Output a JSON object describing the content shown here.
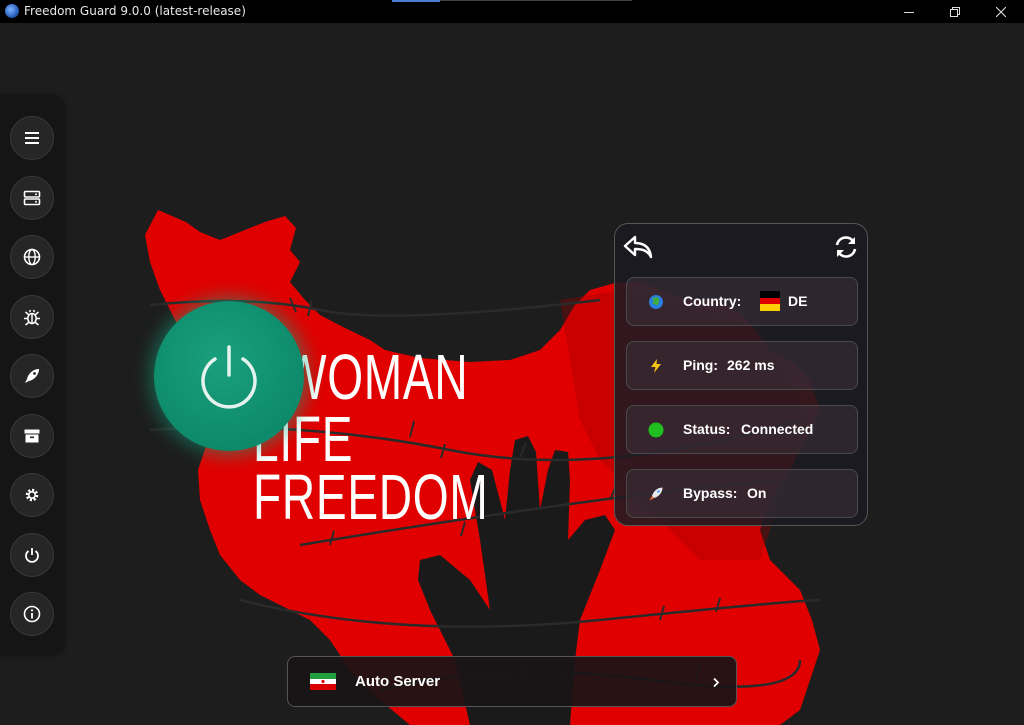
{
  "window": {
    "title": "Freedom Guard 9.0.0 (latest-release)",
    "minimize_icon": "minimize-icon",
    "maximize_icon": "restore-icon",
    "close_icon": "close-icon"
  },
  "sidebar": {
    "items": [
      {
        "name": "menu",
        "icon": "hamburger-icon"
      },
      {
        "name": "servers",
        "icon": "server-icon"
      },
      {
        "name": "browser",
        "icon": "globe-icon"
      },
      {
        "name": "debug",
        "icon": "bug-icon"
      },
      {
        "name": "boost",
        "icon": "rocket-icon"
      },
      {
        "name": "archive",
        "icon": "archive-icon"
      },
      {
        "name": "settings",
        "icon": "gear-icon"
      },
      {
        "name": "power",
        "icon": "power-icon"
      },
      {
        "name": "about",
        "icon": "info-icon"
      }
    ]
  },
  "poster": {
    "line1": "WOMAN",
    "line2": "LIFE",
    "line3": "FREEDOM",
    "map_color": "#e00000"
  },
  "connect_button": {
    "icon": "power-icon",
    "color": "#0d8a6a"
  },
  "info": {
    "back_icon": "reply-icon",
    "refresh_icon": "refresh-icon",
    "country_label": "Country:",
    "country_value": "DE",
    "country_flag": "germany-flag",
    "ping_label": "Ping:",
    "ping_value": "262 ms",
    "status_label": "Status:",
    "status_value": "Connected",
    "status_color": "#1fbf1f",
    "bypass_label": "Bypass:",
    "bypass_value": "On"
  },
  "server": {
    "label": "Auto Server",
    "flag": "iran-flag",
    "chevron": "chevron-right-icon"
  }
}
